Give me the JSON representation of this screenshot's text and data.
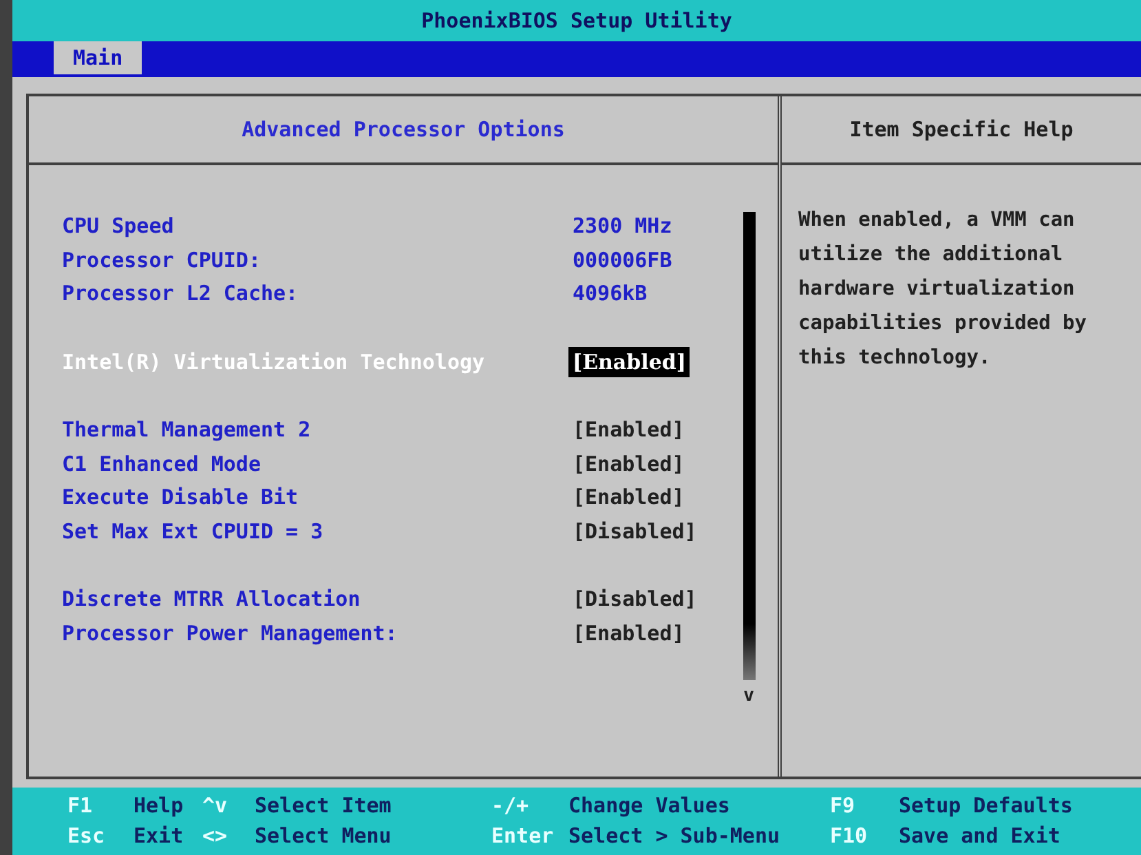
{
  "window": {
    "title": "PhoenixBIOS Setup Utility"
  },
  "menu": [
    {
      "label": "Main",
      "selected": true
    }
  ],
  "panel": {
    "title": "Advanced Processor Options",
    "groups": [
      {
        "items": [
          {
            "label": "CPU Speed",
            "value": "2300 MHz",
            "kind": "info",
            "selected": false
          },
          {
            "label": "Processor CPUID:",
            "value": "000006FB",
            "kind": "info",
            "selected": false
          },
          {
            "label": "Processor L2 Cache:",
            "value": "4096kB",
            "kind": "info",
            "selected": false
          }
        ]
      },
      {
        "items": [
          {
            "label": "Intel(R) Virtualization Technology",
            "value": "[Enabled]",
            "kind": "option",
            "selected": true
          }
        ]
      },
      {
        "items": [
          {
            "label": "Thermal Management 2",
            "value": "[Enabled]",
            "kind": "option",
            "selected": false
          },
          {
            "label": "C1 Enhanced Mode",
            "value": "[Enabled]",
            "kind": "option",
            "selected": false
          },
          {
            "label": "Execute Disable Bit",
            "value": "[Enabled]",
            "kind": "option",
            "selected": false
          },
          {
            "label": "Set Max Ext CPUID = 3",
            "value": "[Disabled]",
            "kind": "option",
            "selected": false
          }
        ]
      },
      {
        "items": [
          {
            "label": "Discrete MTRR Allocation",
            "value": "[Disabled]",
            "kind": "option",
            "selected": false
          },
          {
            "label": "Processor Power Management:",
            "value": "[Enabled]",
            "kind": "option",
            "selected": false
          }
        ]
      }
    ],
    "scroll_mark": "v"
  },
  "help": {
    "title": "Item Specific Help",
    "text": "When enabled, a VMM can utilize the additional hardware virtualization capabilities provided by this technology."
  },
  "footer": [
    [
      {
        "key": "F1",
        "action": "Help"
      },
      {
        "key": "^v",
        "action": "Select Item"
      },
      {
        "key": "-/+",
        "action": "Change Values"
      },
      {
        "key": "F9",
        "action": "Setup Defaults"
      }
    ],
    [
      {
        "key": "Esc",
        "action": "Exit"
      },
      {
        "key": "<>",
        "action": "Select Menu"
      },
      {
        "key": "Enter",
        "action": "Select > Sub-Menu"
      },
      {
        "key": "F10",
        "action": "Save and Exit"
      }
    ]
  ]
}
